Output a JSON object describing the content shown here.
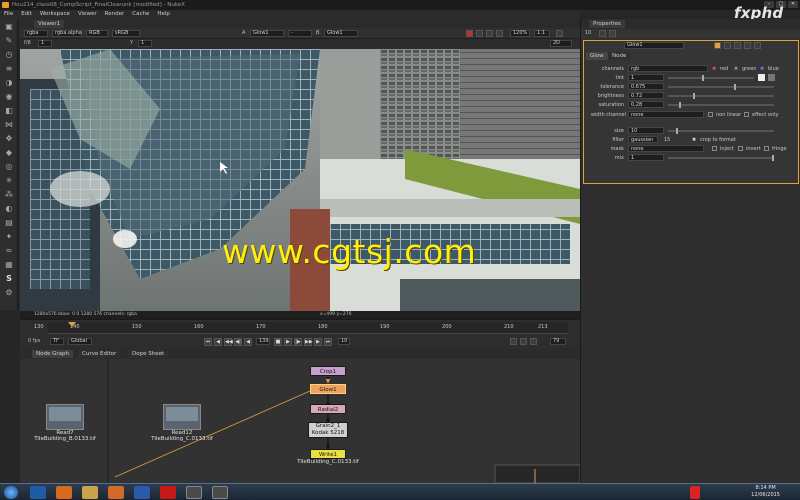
{
  "window": {
    "title": "Hou214_class08_CompScript_FinalClearunk [modified] - NukeX",
    "controls": [
      "–",
      "□",
      "✕"
    ]
  },
  "brand": "fxphd",
  "watermark": "www.cgtsj.com",
  "menu": [
    "File",
    "Edit",
    "Workspace",
    "Viewer",
    "Render",
    "Cache",
    "Help"
  ],
  "viewer": {
    "tab_label": "Viewer1",
    "channels": "rgba",
    "alpha": "rgba.alpha",
    "colorspace": "RGB",
    "lut": "sRGB",
    "input_a_label": "A",
    "input_a": "Glow1",
    "input_b_label": "B",
    "input_b": "Glow1",
    "zoom": "120%",
    "ratio": "1:1",
    "frame_label": "f/8",
    "frame_value": "1",
    "gain_label": "Y",
    "gain_value": "1",
    "mode": "2D",
    "info_left": "1280x576  bbox: 0 0 1280 576 channels: rgba",
    "info_right": "x=499 y=270"
  },
  "timeline": {
    "ticks": [
      "130",
      "140",
      "150",
      "160",
      "170",
      "180",
      "190",
      "200",
      "210",
      "213"
    ],
    "fps": "0 fps",
    "tf": "TF",
    "global": "Global",
    "current_frame": "139",
    "step": "10",
    "end_frame": "79",
    "buttons": [
      "⏮",
      "◀",
      "◀◀",
      "◀|",
      "◀",
      "■",
      "▶",
      "|▶",
      "▶▶",
      "▶",
      "⏭"
    ]
  },
  "node_graph": {
    "tabs": [
      "Node Graph",
      "Curve Editor",
      "Dope Sheet"
    ],
    "nodes": {
      "crop": "Crop1",
      "glow": "Glow1",
      "radial": "Radial2",
      "grain_line1": "Grain2_1",
      "grain_line2": "Kodak 5218",
      "write": "Write1",
      "write_file": "TileBuilding_C.0133.tif",
      "read7": "Read7",
      "read7_file": "TileBuilding_B.0133.tif",
      "read12": "Read12",
      "read12_file": "TileBuilding_C.0133.tif"
    }
  },
  "properties": {
    "tab_label": "Properties",
    "count": "10",
    "node_name": "Glow1",
    "sub_tabs": [
      "Glow",
      "Node"
    ],
    "channels_label": "channels",
    "channels_value": "rgb",
    "channel_toggles": [
      "red",
      "green",
      "blue"
    ],
    "rows": [
      {
        "label": "tint",
        "value": "1"
      },
      {
        "label": "tolerance",
        "value": "0.675"
      },
      {
        "label": "brightness",
        "value": "0.72"
      },
      {
        "label": "saturation",
        "value": "0.28"
      }
    ],
    "width_channel_label": "width channel",
    "width_channel_value": "none",
    "non_linear": "non linear",
    "effect_only": "effect only",
    "size_label": "size",
    "size_value": "10",
    "filter_label": "filter",
    "filter_value": "gaussian",
    "filter_quality": "15",
    "crop_to_format": "crop to format",
    "mask_label": "mask",
    "mask_value": "none",
    "inject": "inject",
    "invert": "invert",
    "fringe": "fringe",
    "mix_label": "mix",
    "mix_value": "1"
  },
  "taskbar": {
    "time": "8:14 PM",
    "date": "12/06/2015"
  },
  "colors": {
    "accent": "#e0a040",
    "watermark": "#ffee10",
    "viewer_bg": "#000000"
  }
}
